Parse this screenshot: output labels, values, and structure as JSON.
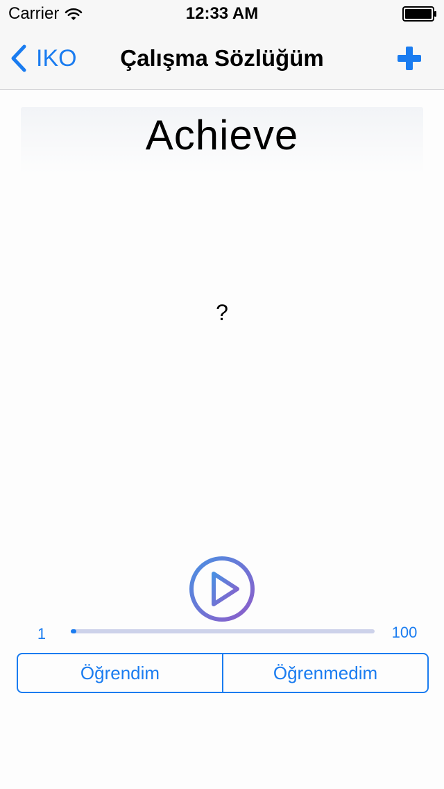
{
  "status_bar": {
    "carrier": "Carrier",
    "time": "12:33 AM",
    "wifi_icon": "wifi-icon",
    "battery_icon": "battery-icon"
  },
  "nav_bar": {
    "back_label": "IKO",
    "back_icon": "chevron-left-icon",
    "title": "Çalışma Sözlüğüm",
    "add_icon": "plus-icon"
  },
  "card": {
    "word": "Achieve",
    "meaning": "?"
  },
  "player": {
    "play_icon": "play-icon"
  },
  "progress": {
    "min_label": "1",
    "max_label": "100",
    "current_value": 1,
    "min_value": 1,
    "max_value": 100
  },
  "actions": {
    "learned_label": "Öğrendim",
    "not_learned_label": "Öğrenmedim"
  },
  "colors": {
    "accent": "#1a7cf0",
    "play_gradient_start": "#4a90e2",
    "play_gradient_end": "#8e5cc9",
    "slider_track": "#cdd2ea"
  }
}
